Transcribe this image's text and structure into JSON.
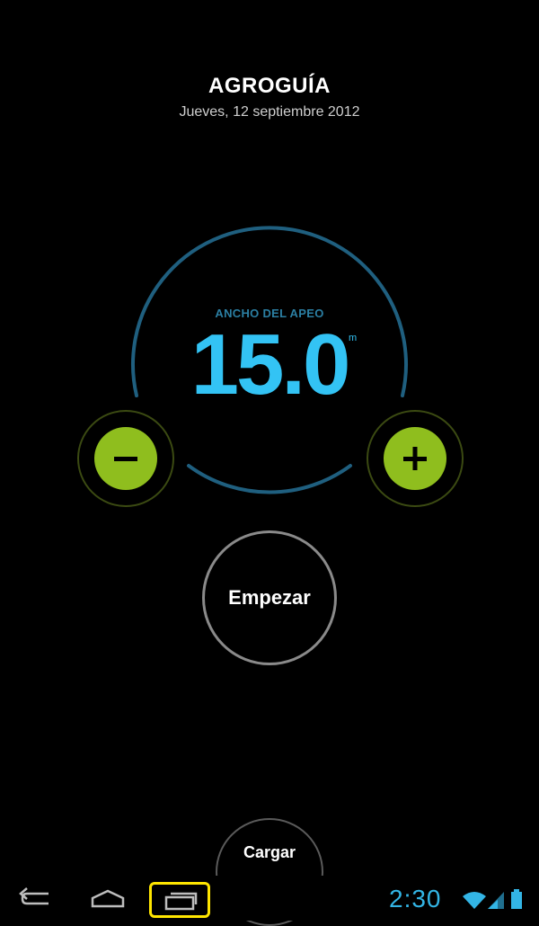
{
  "header": {
    "title": "AGROGUÍA",
    "date": "Jueves, 12 septiembre 2012"
  },
  "dial": {
    "label": "ANCHO DEL APEO",
    "value": "15.0",
    "unit": "m"
  },
  "controls": {
    "decrease_icon": "minus-icon",
    "increase_icon": "plus-icon",
    "start_label": "Empezar",
    "load_label": "Cargar"
  },
  "status_bar": {
    "time": "2:30",
    "icons": [
      "wifi-icon",
      "signal-icon",
      "battery-icon"
    ]
  },
  "nav": {
    "icons": [
      "back-icon",
      "home-icon",
      "recent-apps-icon"
    ]
  },
  "colors": {
    "accent_blue": "#33c3f4",
    "dial_ring": "#1f5f7f",
    "lime": "#8fbe1e",
    "highlight": "#ffe600"
  }
}
